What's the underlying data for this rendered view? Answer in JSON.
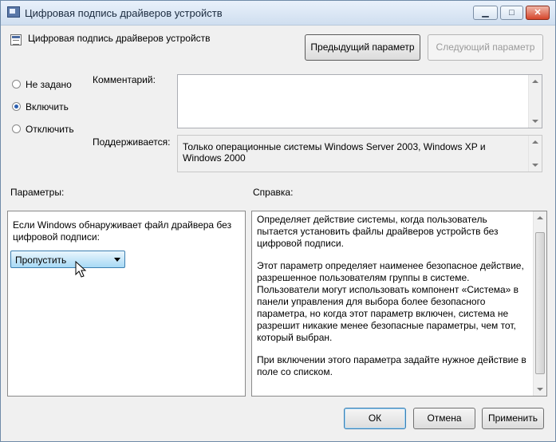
{
  "window": {
    "title": "Цифровая подпись драйверов устройств"
  },
  "header": {
    "policy_name": "Цифровая подпись драйверов устройств",
    "prev_button": "Предыдущий параметр",
    "next_button": "Следующий параметр"
  },
  "state": {
    "options": [
      {
        "label": "Не задано",
        "selected": false
      },
      {
        "label": "Включить",
        "selected": true
      },
      {
        "label": "Отключить",
        "selected": false
      }
    ]
  },
  "comment": {
    "label": "Комментарий:",
    "value": ""
  },
  "supported": {
    "label": "Поддерживается:",
    "value": "Только операционные системы Windows Server 2003, Windows XP и Windows 2000"
  },
  "options_panel": {
    "label": "Параметры:",
    "description": "Если Windows обнаруживает файл драйвера без цифровой подписи:",
    "combo_value": "Пропустить"
  },
  "help_panel": {
    "label": "Справка:",
    "paragraphs": [
      "Определяет действие системы, когда пользователь пытается установить файлы драйверов устройств без цифровой подписи.",
      "Этот параметр определяет наименее безопасное действие, разрешенное пользователям группы в системе. Пользователи могут использовать компонент «Система» в панели управления для выбора более безопасного параметра, но когда этот параметр включен, система не разрешит никакие менее безопасные параметры, чем тот, который выбран.",
      "При включении этого параметра задайте нужное действие в поле со списком."
    ]
  },
  "footer": {
    "ok": "ОК",
    "cancel": "Отмена",
    "apply": "Применить"
  }
}
